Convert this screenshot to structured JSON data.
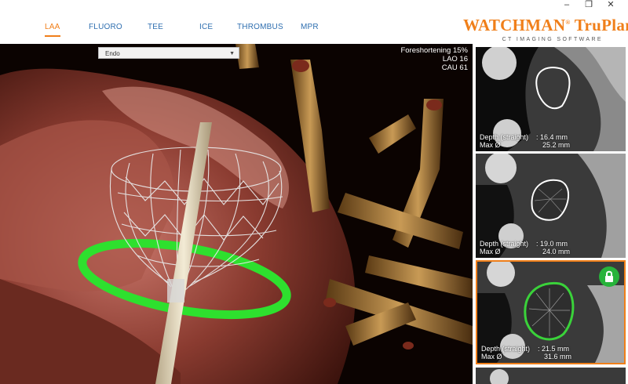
{
  "window_controls": {
    "minimize": "–",
    "maximize": "❐",
    "close": "✕"
  },
  "tabs": [
    {
      "label": "LAA",
      "active": true
    },
    {
      "label": "FLUORO",
      "active": false
    },
    {
      "label": "TEE",
      "active": false
    },
    {
      "label": "ICE",
      "active": false
    },
    {
      "label": "THROMBUS",
      "active": false
    },
    {
      "label": "MPR",
      "active": false
    }
  ],
  "brand": {
    "name": "WATCHMAN",
    "mark": "®",
    "product": " TruPlan",
    "trademark": "™",
    "subtitle": "CT IMAGING SOFTWARE"
  },
  "viewport": {
    "view_select": {
      "value": "Endo",
      "icon": "chevron-down-icon"
    },
    "foreshortening": "Foreshortening 15%",
    "lao": "LAO 16",
    "cau": "CAU 61"
  },
  "thumbnails": [
    {
      "depth_label": "Depth (straight)",
      "depth_value": ": 16.4 mm",
      "max_label": "Max Ø",
      "max_value": "25.2 mm",
      "contour_color": "#ffffff",
      "selected": false,
      "locked": false
    },
    {
      "depth_label": "Depth (straight)",
      "depth_value": ": 19.0 mm",
      "max_label": "Max Ø",
      "max_value": "24.0 mm",
      "contour_color": "#ffffff",
      "selected": false,
      "locked": false
    },
    {
      "depth_label": "Depth (straight)",
      "depth_value": ": 21.5 mm",
      "max_label": "Max Ø",
      "max_value": "31.6 mm",
      "contour_color": "#3ad23a",
      "selected": true,
      "locked": true,
      "lock_icon": "lock-icon"
    }
  ],
  "colors": {
    "accent": "#f07f1a",
    "tab_blue": "#2f6fb0",
    "ring_green": "#2ee02e",
    "lock_green": "#27b33a"
  }
}
